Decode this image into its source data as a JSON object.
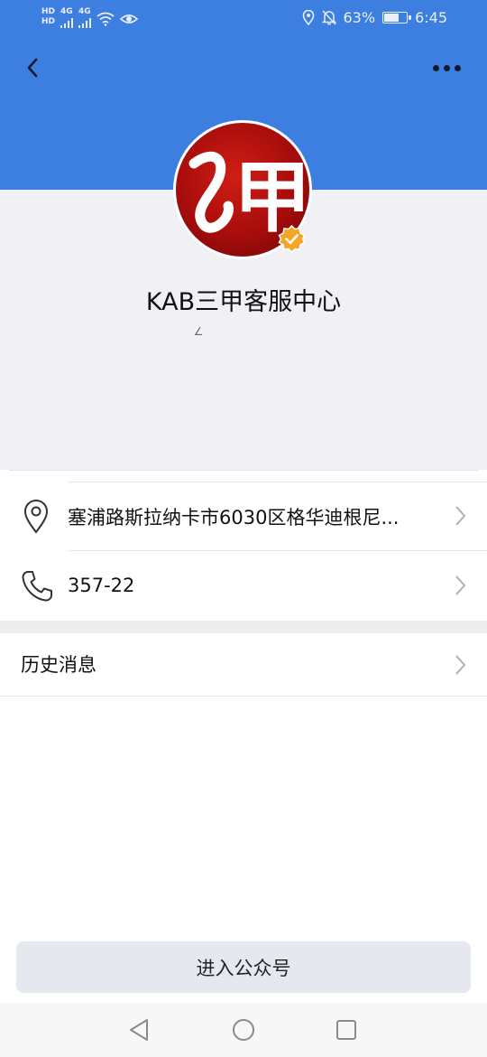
{
  "status_bar": {
    "hd_label": "HD",
    "network_label": "4G",
    "battery_percent": "63%",
    "time": "6:45",
    "battery_level": 0.63
  },
  "header": {
    "back_icon": "chevron-left-icon",
    "more_icon": "more-dots-icon",
    "accent_color": "#3d7fe0"
  },
  "profile": {
    "name": "KAB三甲客服中心",
    "subtitle": "∠",
    "avatar_glyph": "甲",
    "verified_icon": "verified-check-icon"
  },
  "info": {
    "address": "塞浦路斯拉纳卡市6030区格华迪根尼...",
    "phone": "357-22"
  },
  "history": {
    "label": "历史消息"
  },
  "actions": {
    "enter_label": "进入公众号"
  }
}
